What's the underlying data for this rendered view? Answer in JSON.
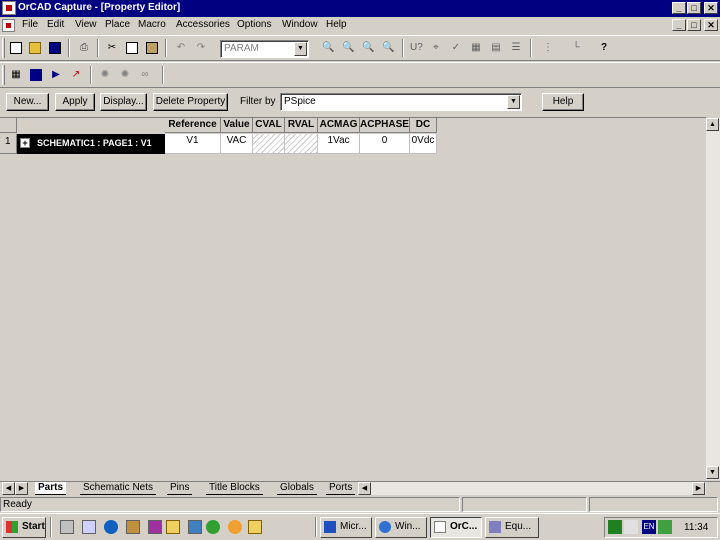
{
  "window": {
    "title": "OrCAD Capture - [Property Editor]"
  },
  "menu": [
    "File",
    "Edit",
    "View",
    "Place",
    "Macro",
    "Accessories",
    "Options",
    "Window",
    "Help"
  ],
  "toolbar": {
    "combo_value": "PARAM"
  },
  "editor": {
    "buttons": {
      "new": "New...",
      "apply": "Apply",
      "display": "Display...",
      "delete": "Delete Property"
    },
    "filter_label": "Filter by",
    "filter_value": "PSpice",
    "help": "Help"
  },
  "grid": {
    "headers": [
      "Reference",
      "Value",
      "CVAL",
      "RVAL",
      "ACMAG",
      "ACPHASE",
      "DC"
    ],
    "row_number": "1",
    "expand_glyph": "+",
    "row_label": "SCHEMATIC1 : PAGE1 : V1",
    "cells": [
      "V1",
      "VAC",
      "",
      "",
      "1Vac",
      "0",
      "0Vdc"
    ]
  },
  "tabs": [
    "Parts",
    "Schematic Nets",
    "Pins",
    "Title Blocks",
    "Globals",
    "Ports"
  ],
  "status": {
    "text": "Ready"
  },
  "taskbar": {
    "start": "Start",
    "tasks": [
      "Micr...",
      "Win...",
      "OrC...",
      "Equ..."
    ],
    "clock": "11:34",
    "lang": "EN"
  },
  "colors": {
    "title_bar": "#000080",
    "face": "#d4d0c8",
    "selected_row": "#000000"
  }
}
